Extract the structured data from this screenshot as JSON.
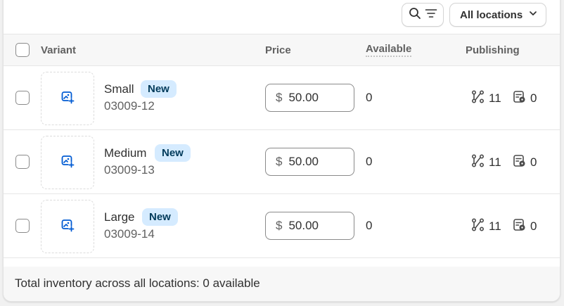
{
  "toolbar": {
    "location_label": "All locations",
    "search_icon": "search-icon",
    "filter_icon": "filter-icon",
    "chevron_icon": "chevron-down-icon"
  },
  "table": {
    "headers": {
      "variant": "Variant",
      "price": "Price",
      "available": "Available",
      "publishing": "Publishing"
    },
    "rows": [
      {
        "name": "Small",
        "badge": "New",
        "sku": "03009-12",
        "currency": "$",
        "price": "50.00",
        "available": "0",
        "channels": "11",
        "catalogs": "0"
      },
      {
        "name": "Medium",
        "badge": "New",
        "sku": "03009-13",
        "currency": "$",
        "price": "50.00",
        "available": "0",
        "channels": "11",
        "catalogs": "0"
      },
      {
        "name": "Large",
        "badge": "New",
        "sku": "03009-14",
        "currency": "$",
        "price": "50.00",
        "available": "0",
        "channels": "11",
        "catalogs": "0"
      }
    ]
  },
  "footer": {
    "total_text": "Total inventory across all locations: 0 available"
  },
  "colors": {
    "badge_bg": "#d5ebff",
    "badge_text": "#003a5a",
    "image_icon": "#005bd3"
  }
}
